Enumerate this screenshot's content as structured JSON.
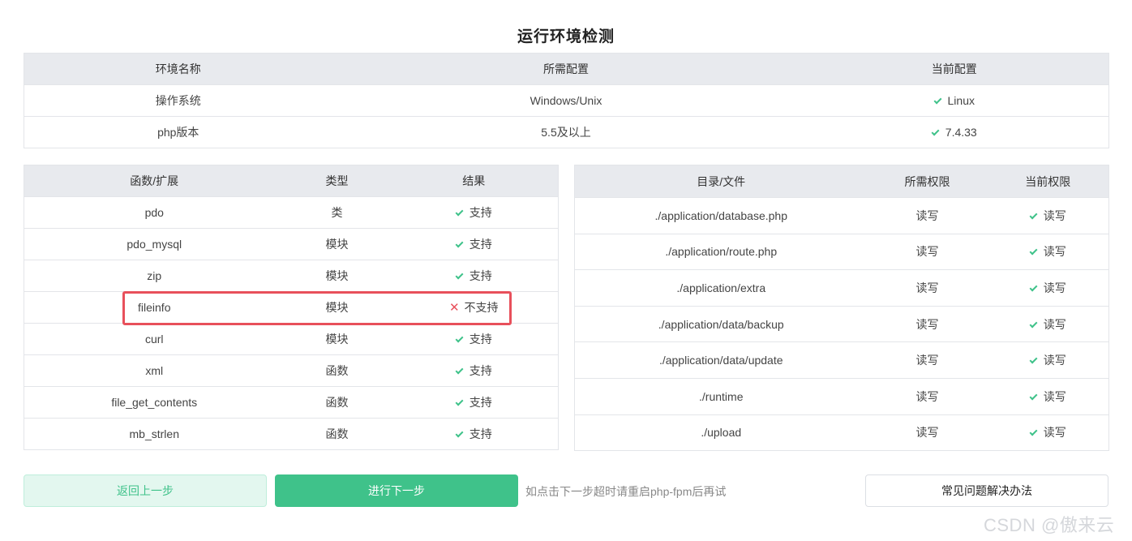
{
  "page_title": "运行环境检测",
  "env": {
    "headers": [
      "环境名称",
      "所需配置",
      "当前配置"
    ],
    "rows": [
      {
        "name": "操作系统",
        "required": "Windows/Unix",
        "current": "Linux"
      },
      {
        "name": "php版本",
        "required": "5.5及以上",
        "current": "7.4.33"
      }
    ]
  },
  "functions": {
    "headers": [
      "函数/扩展",
      "类型",
      "结果"
    ],
    "rows": [
      {
        "name": "pdo",
        "type": "类",
        "result": "支持",
        "ok": true
      },
      {
        "name": "pdo_mysql",
        "type": "模块",
        "result": "支持",
        "ok": true
      },
      {
        "name": "zip",
        "type": "模块",
        "result": "支持",
        "ok": true
      },
      {
        "name": "fileinfo",
        "type": "模块",
        "result": "不支持",
        "ok": false
      },
      {
        "name": "curl",
        "type": "模块",
        "result": "支持",
        "ok": true
      },
      {
        "name": "xml",
        "type": "函数",
        "result": "支持",
        "ok": true
      },
      {
        "name": "file_get_contents",
        "type": "函数",
        "result": "支持",
        "ok": true
      },
      {
        "name": "mb_strlen",
        "type": "函数",
        "result": "支持",
        "ok": true
      }
    ]
  },
  "directories": {
    "headers": [
      "目录/文件",
      "所需权限",
      "当前权限"
    ],
    "rows": [
      {
        "path": "./application/database.php",
        "required": "读写",
        "current": "读写"
      },
      {
        "path": "./application/route.php",
        "required": "读写",
        "current": "读写"
      },
      {
        "path": "./application/extra",
        "required": "读写",
        "current": "读写"
      },
      {
        "path": "./application/data/backup",
        "required": "读写",
        "current": "读写"
      },
      {
        "path": "./application/data/update",
        "required": "读写",
        "current": "读写"
      },
      {
        "path": "./runtime",
        "required": "读写",
        "current": "读写"
      },
      {
        "path": "./upload",
        "required": "读写",
        "current": "读写"
      }
    ]
  },
  "buttons": {
    "back": "返回上一步",
    "next": "进行下一步",
    "hint": "如点击下一步超时请重启php-fpm后再试",
    "faq": "常见问题解决办法"
  },
  "watermark": "CSDN @傲来云",
  "colors": {
    "accent": "#3fc28a",
    "error": "#e8505b",
    "header_bg": "#e8eaee"
  }
}
